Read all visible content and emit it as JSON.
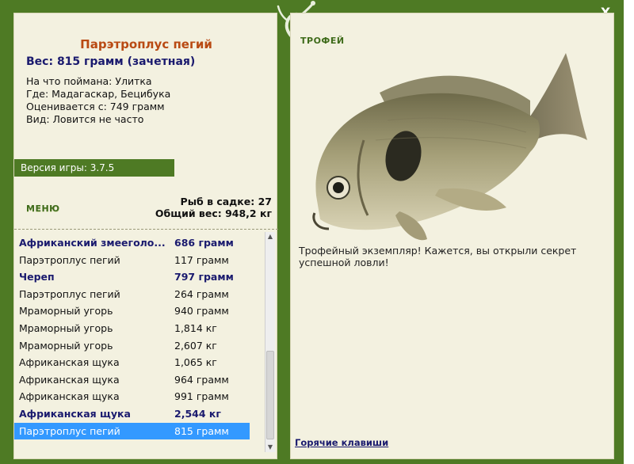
{
  "window": {
    "close_label": "X"
  },
  "fish": {
    "name": "Парэтроплус пегий",
    "weight": "Вес: 815 грамм (зачетная)",
    "bait": "На что поймана: Улитка",
    "location": "Где: Мадагаскар, Бецибука",
    "valued_from": "Оценивается с: 749 грамм",
    "kind": "Вид: Ловится не часто"
  },
  "version": "Версия игры: 3.7.5",
  "menu_label": "МЕНЮ",
  "keepnet": {
    "count": "Рыб в садке: 27",
    "total": "Общий вес: 948,2 кг"
  },
  "catch_list": [
    {
      "name": "Африканский змееголо...",
      "weight": "686 грамм",
      "bold": true
    },
    {
      "name": "Парэтроплус пегий",
      "weight": "117 грамм",
      "bold": false
    },
    {
      "name": "Череп",
      "weight": "797 грамм",
      "bold": true
    },
    {
      "name": "Парэтроплус пегий",
      "weight": "264 грамм",
      "bold": false
    },
    {
      "name": "Мраморный угорь",
      "weight": "940 грамм",
      "bold": false
    },
    {
      "name": "Мраморный угорь",
      "weight": "1,814 кг",
      "bold": false
    },
    {
      "name": "Мраморный угорь",
      "weight": "2,607 кг",
      "bold": false
    },
    {
      "name": "Африканская щука",
      "weight": "1,065 кг",
      "bold": false
    },
    {
      "name": "Африканская щука",
      "weight": "964 грамм",
      "bold": false
    },
    {
      "name": "Африканская щука",
      "weight": "991 грамм",
      "bold": false
    },
    {
      "name": "Африканская щука",
      "weight": "2,544 кг",
      "bold": true
    },
    {
      "name": "Парэтроплус пегий",
      "weight": "815 грамм",
      "bold": false,
      "selected": true
    }
  ],
  "trophy": {
    "title": "ТРОФЕЙ",
    "text": "Трофейный экземпляр! Кажется, вы открыли секрет успешной ловли!"
  },
  "hotkeys_label": "Горячие клавиши",
  "icons": {
    "close": "close-icon",
    "lizard": "lizard-icon",
    "fish": "fish-image",
    "scroll_up": "scroll-up-icon",
    "scroll_down": "scroll-down-icon"
  },
  "colors": {
    "frame": "#4e7a24",
    "panel": "#f3f1e0",
    "selection": "#3399ff",
    "name": "#b94a13",
    "accent": "#1a1a6e"
  }
}
